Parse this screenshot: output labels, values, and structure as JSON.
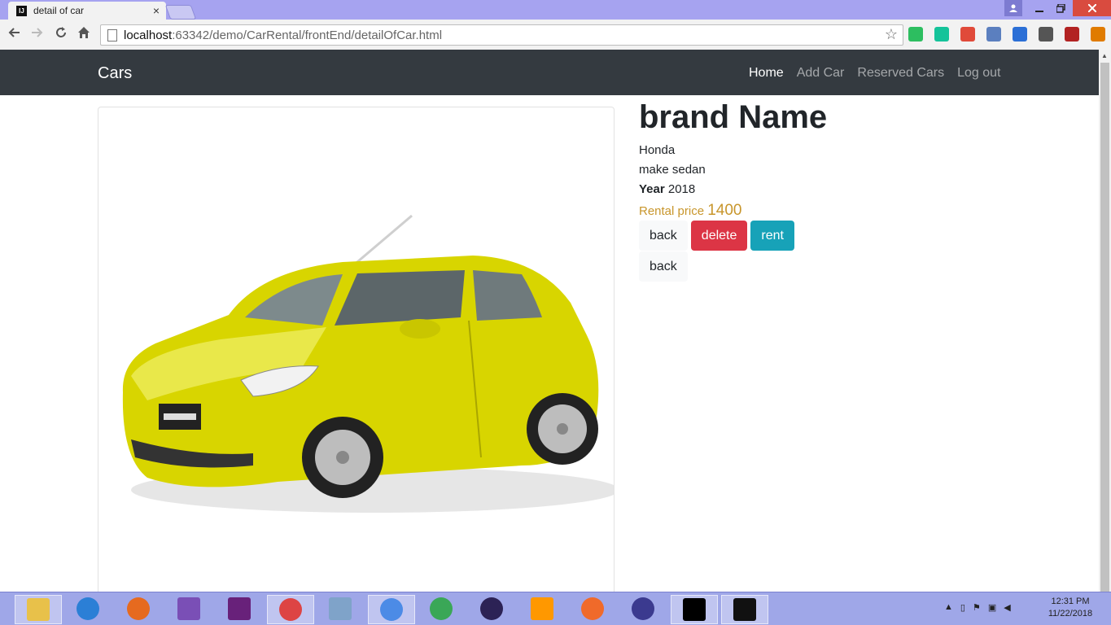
{
  "window": {
    "tab_title": "detail of car",
    "tab_close": "×",
    "favicon_text": "IJ"
  },
  "toolbar": {
    "url_host": "localhost",
    "url_path": ":63342/demo/CarRental/frontEnd/detailOfCar.html",
    "extensions": [
      {
        "name": "evernote-icon",
        "color": "#2dbe60"
      },
      {
        "name": "grammarly-icon",
        "color": "#15c39a"
      },
      {
        "name": "pdf-icon",
        "color": "#e04a3a"
      },
      {
        "name": "camera-icon",
        "color": "#5b7fbf"
      },
      {
        "name": "sync-icon",
        "color": "#2b6fd6"
      },
      {
        "name": "shield-icon",
        "color": "#555555"
      },
      {
        "name": "em-icon",
        "color": "#b22222"
      },
      {
        "name": "menu-icon",
        "color": "#e07b00"
      }
    ]
  },
  "navbar": {
    "brand": "Cars",
    "links": [
      {
        "label": "Home",
        "active": true
      },
      {
        "label": "Add Car",
        "active": false
      },
      {
        "label": "Reserved Cars",
        "active": false
      },
      {
        "label": "Log out",
        "active": false
      }
    ]
  },
  "detail": {
    "heading": "brand Name",
    "brand": "Honda",
    "make": "make sedan",
    "year_label": "Year",
    "year_value": "2018",
    "price_label": "Rental price",
    "price_value": "1400",
    "buttons": {
      "back": "back",
      "delete": "delete",
      "rent": "rent",
      "back2": "back"
    }
  },
  "taskbar": {
    "time": "12:31 PM",
    "date": "11/22/2018"
  }
}
